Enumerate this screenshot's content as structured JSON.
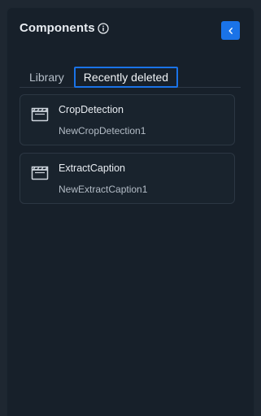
{
  "header": {
    "title": "Components",
    "info_icon": "info-icon",
    "collapse_icon": "chevron-left-icon"
  },
  "tabs": [
    {
      "label": "Library",
      "active": false
    },
    {
      "label": "Recently deleted",
      "active": true
    }
  ],
  "items": [
    {
      "name": "CropDetection",
      "subtitle": "NewCropDetection1",
      "icon": "film-clapper-icon"
    },
    {
      "name": "ExtractCaption",
      "subtitle": "NewExtractCaption1",
      "icon": "film-clapper-icon"
    }
  ],
  "colors": {
    "accent": "#1a73e8",
    "panel_bg": "#17202a",
    "page_bg": "#1e2731"
  }
}
